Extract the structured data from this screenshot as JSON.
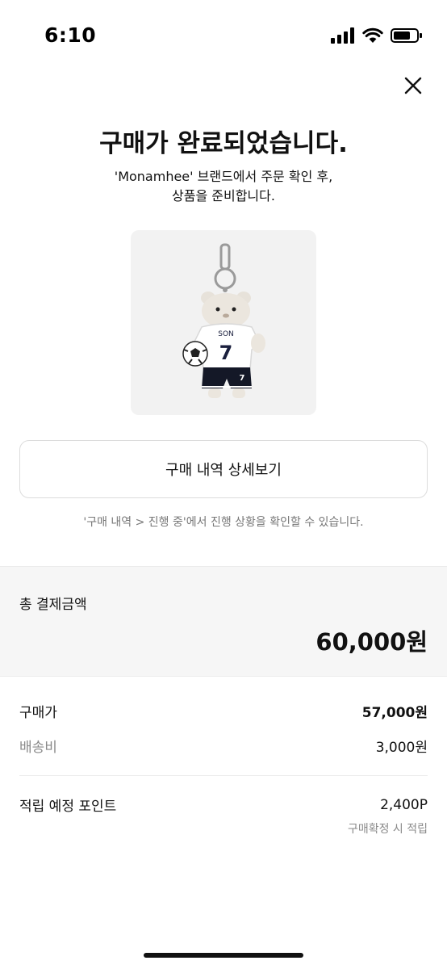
{
  "status_bar": {
    "time": "6:10",
    "icons": [
      "signal-icon",
      "wifi-icon",
      "battery-icon"
    ]
  },
  "header": {
    "close_icon": "close-icon"
  },
  "confirmation": {
    "title": "구매가 완료되었습니다.",
    "subtitle_line1": "'Monamhee' 브랜드에서 주문 확인 후,",
    "subtitle_line2": "상품을 준비합니다."
  },
  "product": {
    "jersey_name": "SON",
    "jersey_number": "7",
    "shorts_number": "7"
  },
  "actions": {
    "detail_button_label": "구매 내역 상세보기",
    "hint": "'구매 내역 > 진행 중'에서 진행 상황을 확인할 수 있습니다."
  },
  "payment": {
    "total_label": "총 결제금액",
    "total_value": "60,000원",
    "purchase_label": "구매가",
    "purchase_value": "57,000원",
    "shipping_label": "배송비",
    "shipping_value": "3,000원",
    "points_label": "적립 예정 포인트",
    "points_value": "2,400P",
    "points_note": "구매확정 시 적립"
  },
  "colors": {
    "text_primary": "#111111",
    "text_secondary": "#8a8a8a",
    "section_bg": "#f6f6f6",
    "border": "#dcdcdc"
  }
}
